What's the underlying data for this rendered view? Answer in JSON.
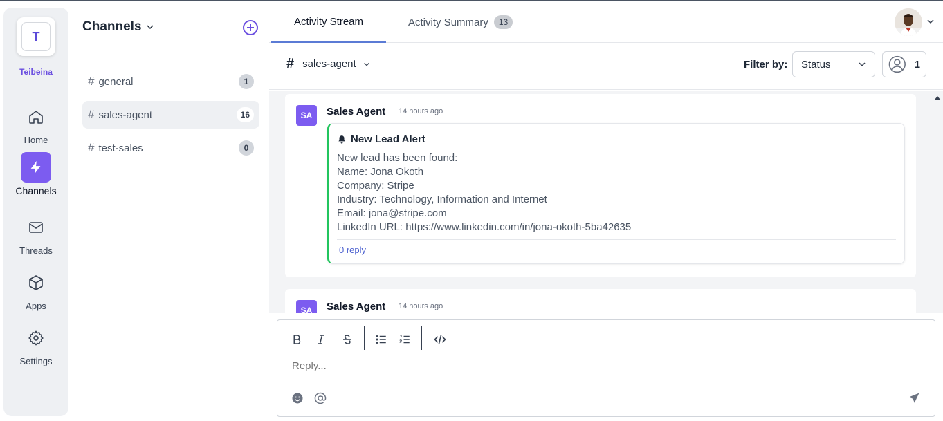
{
  "workspace": {
    "initial": "T",
    "name": "Teibeina"
  },
  "rail": [
    {
      "label": "Home",
      "icon": "home-icon"
    },
    {
      "label": "Channels",
      "icon": "bolt-icon",
      "active": true
    },
    {
      "label": "Threads",
      "icon": "mail-icon"
    },
    {
      "label": "Apps",
      "icon": "cube-icon"
    },
    {
      "label": "Settings",
      "icon": "gear-icon"
    }
  ],
  "channels_panel": {
    "title": "Channels",
    "items": [
      {
        "name": "general",
        "count": "1"
      },
      {
        "name": "sales-agent",
        "count": "16",
        "active": true
      },
      {
        "name": "test-sales",
        "count": "0"
      }
    ]
  },
  "tabs": [
    {
      "label": "Activity Stream",
      "active": true
    },
    {
      "label": "Activity Summary",
      "count": "13"
    }
  ],
  "toolbar": {
    "channel": "sales-agent",
    "filter_label": "Filter by:",
    "status_value": "Status",
    "user_count": "1"
  },
  "messages": [
    {
      "initials": "SA",
      "author": "Sales Agent",
      "time": "14 hours ago",
      "title": "New Lead Alert",
      "lines": [
        "New lead has been found:",
        "Name: Jona Okoth",
        "Company: Stripe",
        "Industry: Technology, Information and Internet",
        "Email: jona@stripe.com",
        "LinkedIn URL: https://www.linkedin.com/in/jona-okoth-5ba42635"
      ],
      "replies": "0 reply"
    },
    {
      "initials": "SA",
      "author": "Sales Agent",
      "time": "14 hours ago"
    }
  ],
  "composer": {
    "placeholder": "Reply..."
  },
  "colors": {
    "accent": "#7c5cf0",
    "lead_border": "#22c55e",
    "link": "#4a5fcf"
  }
}
